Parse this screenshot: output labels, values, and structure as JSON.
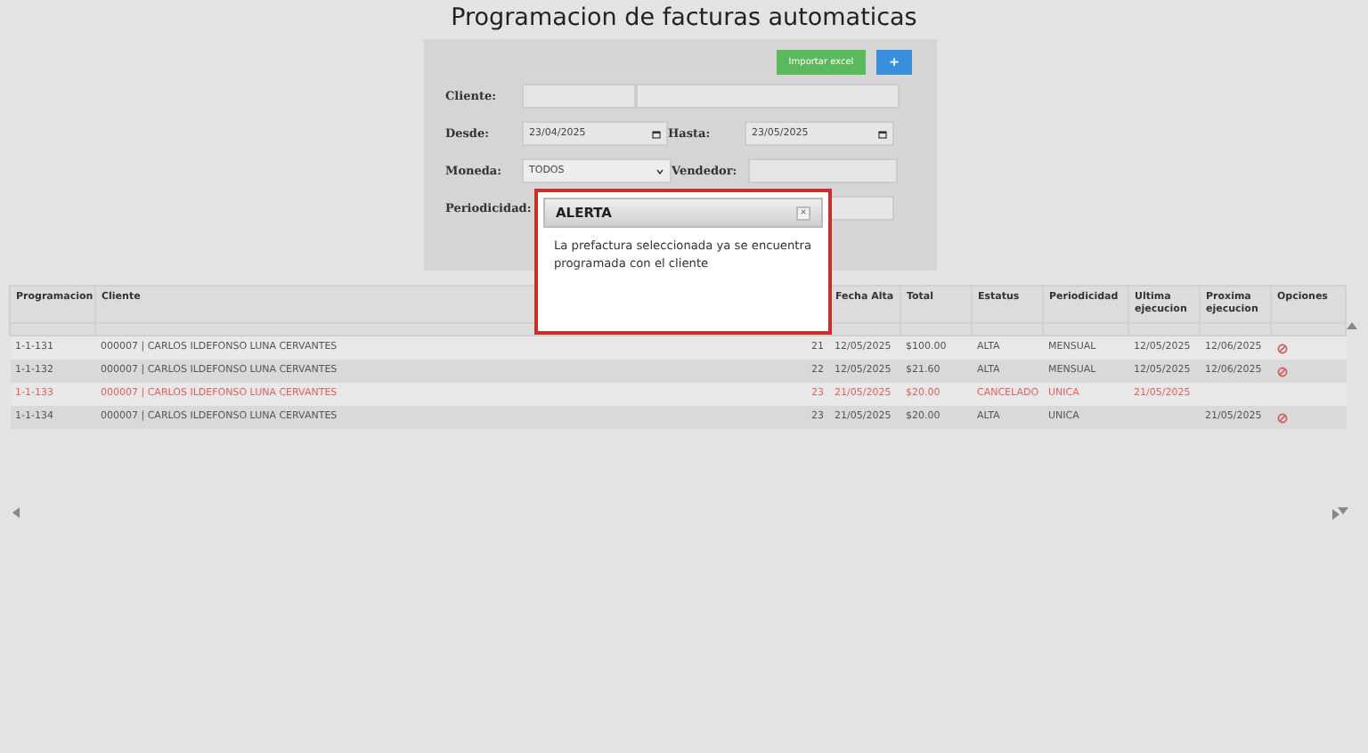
{
  "title": "Programacion de facturas automaticas",
  "toolbar": {
    "import_button": "Importar excel",
    "add_button": "+"
  },
  "form": {
    "cliente": {
      "label": "Cliente:"
    },
    "desde": {
      "label": "Desde:",
      "value": "23/04/2025"
    },
    "hasta": {
      "label": "Hasta:",
      "value": "23/05/2025"
    },
    "moneda": {
      "label": "Moneda:",
      "value": "TODOS"
    },
    "vendedor": {
      "label": "Vendedor:"
    },
    "periodicidad": {
      "label": "Periodicidad:"
    }
  },
  "table": {
    "columns": [
      {
        "label": "Programacion"
      },
      {
        "label": "Cliente"
      },
      {},
      {
        "label": "Fecha Alta"
      },
      {
        "label": "Total"
      },
      {
        "label": "Estatus"
      },
      {
        "label": "Periodicidad"
      },
      {
        "label": "Ultima ejecucion"
      },
      {
        "label": "Proxima ejecucion"
      },
      {
        "label": "Opciones"
      }
    ],
    "rows": [
      {
        "cancelled": false,
        "cancel_option": true,
        "cells": [
          "1-1-131",
          "000007 | CARLOS ILDEFONSO LUNA CERVANTES",
          "21",
          "12/05/2025",
          "$100.00",
          "ALTA",
          "MENSUAL",
          "12/05/2025",
          "12/06/2025"
        ]
      },
      {
        "cancelled": false,
        "cancel_option": true,
        "cells": [
          "1-1-132",
          "000007 | CARLOS ILDEFONSO LUNA CERVANTES",
          "22",
          "12/05/2025",
          "$21.60",
          "ALTA",
          "MENSUAL",
          "12/05/2025",
          "12/06/2025"
        ]
      },
      {
        "cancelled": true,
        "cancel_option": false,
        "cells": [
          "1-1-133",
          "000007 | CARLOS ILDEFONSO LUNA CERVANTES",
          "23",
          "21/05/2025",
          "$20.00",
          "CANCELADO",
          "UNICA",
          "21/05/2025",
          ""
        ]
      },
      {
        "cancelled": false,
        "cancel_option": true,
        "cells": [
          "1-1-134",
          "000007 | CARLOS ILDEFONSO LUNA CERVANTES",
          "23",
          "21/05/2025",
          "$20.00",
          "ALTA",
          "UNICA",
          "",
          "21/05/2025"
        ]
      }
    ]
  },
  "alert": {
    "title": "ALERTA",
    "close": "×",
    "message": "La prefactura seleccionada ya se encuentra programada con el cliente"
  }
}
